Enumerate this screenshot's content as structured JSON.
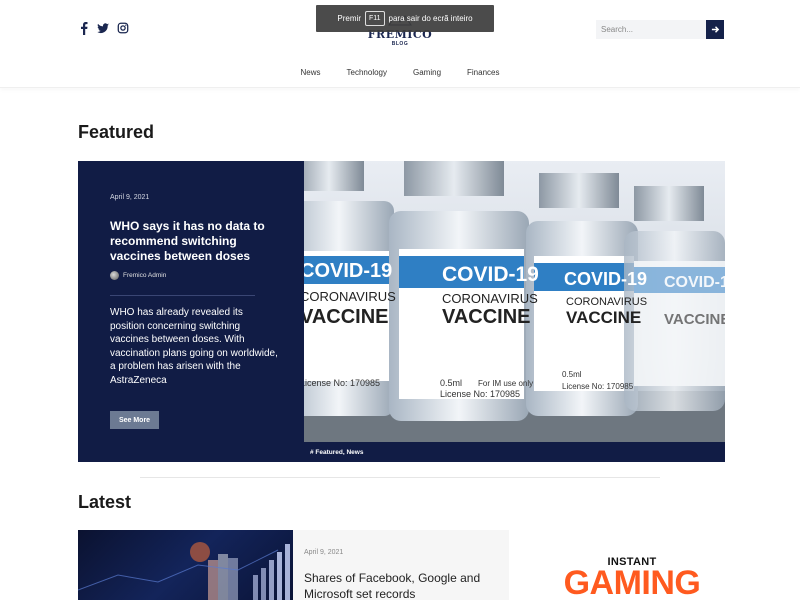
{
  "header": {
    "social": [
      "facebook-icon",
      "twitter-icon",
      "instagram-icon"
    ],
    "logo_name": "FREMICO",
    "logo_sub": "BLOG",
    "search_placeholder": "Search...",
    "nav": [
      "News",
      "Technology",
      "Gaming",
      "Finances"
    ]
  },
  "toast": {
    "before": "Premir",
    "key": "F11",
    "after": "para sair do ecrã inteiro"
  },
  "featured": {
    "section_title": "Featured",
    "date": "April 9, 2021",
    "title": "WHO says it has no data to recommend switching vaccines between doses",
    "author": "Fremico Admin",
    "excerpt": "WHO has already revealed its position concerning switching vaccines between doses. With vaccination plans going on worldwide, a problem has arisen with the AstraZeneca",
    "button": "See More",
    "categories": "# Featured, News",
    "image_text": {
      "label1": "COVID-19",
      "label2": "CORONAVIRUS",
      "label3": "VACCINE",
      "dose": "0.5ml",
      "use": "For IM use only",
      "license": "License No: 170985"
    }
  },
  "latest": {
    "section_title": "Latest",
    "date": "April 9, 2021",
    "title": "Shares of Facebook, Google and Microsoft set records"
  },
  "ad": {
    "top": "INSTANT",
    "big": "GAMING"
  },
  "colors": {
    "navy": "#111c45",
    "accent_orange": "#ff5a1f",
    "button_gray": "#6c7a93"
  }
}
